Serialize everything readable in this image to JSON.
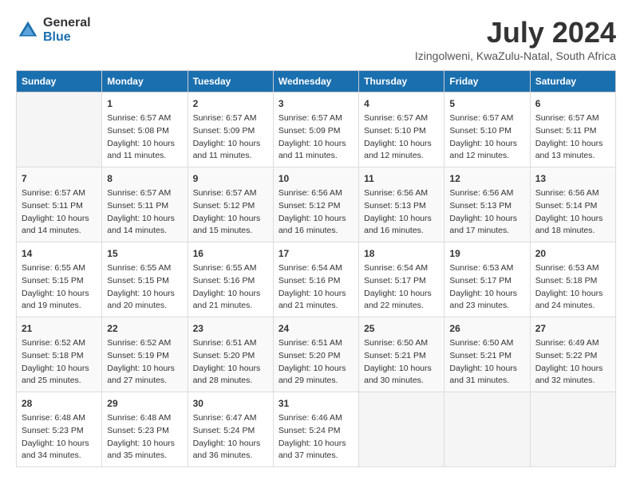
{
  "logo": {
    "general": "General",
    "blue": "Blue"
  },
  "title": "July 2024",
  "location": "Izingolweni, KwaZulu-Natal, South Africa",
  "days_of_week": [
    "Sunday",
    "Monday",
    "Tuesday",
    "Wednesday",
    "Thursday",
    "Friday",
    "Saturday"
  ],
  "weeks": [
    [
      {
        "day": "",
        "sunrise": "",
        "sunset": "",
        "daylight": ""
      },
      {
        "day": "1",
        "sunrise": "Sunrise: 6:57 AM",
        "sunset": "Sunset: 5:08 PM",
        "daylight": "Daylight: 10 hours and 11 minutes."
      },
      {
        "day": "2",
        "sunrise": "Sunrise: 6:57 AM",
        "sunset": "Sunset: 5:09 PM",
        "daylight": "Daylight: 10 hours and 11 minutes."
      },
      {
        "day": "3",
        "sunrise": "Sunrise: 6:57 AM",
        "sunset": "Sunset: 5:09 PM",
        "daylight": "Daylight: 10 hours and 11 minutes."
      },
      {
        "day": "4",
        "sunrise": "Sunrise: 6:57 AM",
        "sunset": "Sunset: 5:10 PM",
        "daylight": "Daylight: 10 hours and 12 minutes."
      },
      {
        "day": "5",
        "sunrise": "Sunrise: 6:57 AM",
        "sunset": "Sunset: 5:10 PM",
        "daylight": "Daylight: 10 hours and 12 minutes."
      },
      {
        "day": "6",
        "sunrise": "Sunrise: 6:57 AM",
        "sunset": "Sunset: 5:11 PM",
        "daylight": "Daylight: 10 hours and 13 minutes."
      }
    ],
    [
      {
        "day": "7",
        "sunrise": "Sunrise: 6:57 AM",
        "sunset": "Sunset: 5:11 PM",
        "daylight": "Daylight: 10 hours and 14 minutes."
      },
      {
        "day": "8",
        "sunrise": "Sunrise: 6:57 AM",
        "sunset": "Sunset: 5:11 PM",
        "daylight": "Daylight: 10 hours and 14 minutes."
      },
      {
        "day": "9",
        "sunrise": "Sunrise: 6:57 AM",
        "sunset": "Sunset: 5:12 PM",
        "daylight": "Daylight: 10 hours and 15 minutes."
      },
      {
        "day": "10",
        "sunrise": "Sunrise: 6:56 AM",
        "sunset": "Sunset: 5:12 PM",
        "daylight": "Daylight: 10 hours and 16 minutes."
      },
      {
        "day": "11",
        "sunrise": "Sunrise: 6:56 AM",
        "sunset": "Sunset: 5:13 PM",
        "daylight": "Daylight: 10 hours and 16 minutes."
      },
      {
        "day": "12",
        "sunrise": "Sunrise: 6:56 AM",
        "sunset": "Sunset: 5:13 PM",
        "daylight": "Daylight: 10 hours and 17 minutes."
      },
      {
        "day": "13",
        "sunrise": "Sunrise: 6:56 AM",
        "sunset": "Sunset: 5:14 PM",
        "daylight": "Daylight: 10 hours and 18 minutes."
      }
    ],
    [
      {
        "day": "14",
        "sunrise": "Sunrise: 6:55 AM",
        "sunset": "Sunset: 5:15 PM",
        "daylight": "Daylight: 10 hours and 19 minutes."
      },
      {
        "day": "15",
        "sunrise": "Sunrise: 6:55 AM",
        "sunset": "Sunset: 5:15 PM",
        "daylight": "Daylight: 10 hours and 20 minutes."
      },
      {
        "day": "16",
        "sunrise": "Sunrise: 6:55 AM",
        "sunset": "Sunset: 5:16 PM",
        "daylight": "Daylight: 10 hours and 21 minutes."
      },
      {
        "day": "17",
        "sunrise": "Sunrise: 6:54 AM",
        "sunset": "Sunset: 5:16 PM",
        "daylight": "Daylight: 10 hours and 21 minutes."
      },
      {
        "day": "18",
        "sunrise": "Sunrise: 6:54 AM",
        "sunset": "Sunset: 5:17 PM",
        "daylight": "Daylight: 10 hours and 22 minutes."
      },
      {
        "day": "19",
        "sunrise": "Sunrise: 6:53 AM",
        "sunset": "Sunset: 5:17 PM",
        "daylight": "Daylight: 10 hours and 23 minutes."
      },
      {
        "day": "20",
        "sunrise": "Sunrise: 6:53 AM",
        "sunset": "Sunset: 5:18 PM",
        "daylight": "Daylight: 10 hours and 24 minutes."
      }
    ],
    [
      {
        "day": "21",
        "sunrise": "Sunrise: 6:52 AM",
        "sunset": "Sunset: 5:18 PM",
        "daylight": "Daylight: 10 hours and 25 minutes."
      },
      {
        "day": "22",
        "sunrise": "Sunrise: 6:52 AM",
        "sunset": "Sunset: 5:19 PM",
        "daylight": "Daylight: 10 hours and 27 minutes."
      },
      {
        "day": "23",
        "sunrise": "Sunrise: 6:51 AM",
        "sunset": "Sunset: 5:20 PM",
        "daylight": "Daylight: 10 hours and 28 minutes."
      },
      {
        "day": "24",
        "sunrise": "Sunrise: 6:51 AM",
        "sunset": "Sunset: 5:20 PM",
        "daylight": "Daylight: 10 hours and 29 minutes."
      },
      {
        "day": "25",
        "sunrise": "Sunrise: 6:50 AM",
        "sunset": "Sunset: 5:21 PM",
        "daylight": "Daylight: 10 hours and 30 minutes."
      },
      {
        "day": "26",
        "sunrise": "Sunrise: 6:50 AM",
        "sunset": "Sunset: 5:21 PM",
        "daylight": "Daylight: 10 hours and 31 minutes."
      },
      {
        "day": "27",
        "sunrise": "Sunrise: 6:49 AM",
        "sunset": "Sunset: 5:22 PM",
        "daylight": "Daylight: 10 hours and 32 minutes."
      }
    ],
    [
      {
        "day": "28",
        "sunrise": "Sunrise: 6:48 AM",
        "sunset": "Sunset: 5:23 PM",
        "daylight": "Daylight: 10 hours and 34 minutes."
      },
      {
        "day": "29",
        "sunrise": "Sunrise: 6:48 AM",
        "sunset": "Sunset: 5:23 PM",
        "daylight": "Daylight: 10 hours and 35 minutes."
      },
      {
        "day": "30",
        "sunrise": "Sunrise: 6:47 AM",
        "sunset": "Sunset: 5:24 PM",
        "daylight": "Daylight: 10 hours and 36 minutes."
      },
      {
        "day": "31",
        "sunrise": "Sunrise: 6:46 AM",
        "sunset": "Sunset: 5:24 PM",
        "daylight": "Daylight: 10 hours and 37 minutes."
      },
      {
        "day": "",
        "sunrise": "",
        "sunset": "",
        "daylight": ""
      },
      {
        "day": "",
        "sunrise": "",
        "sunset": "",
        "daylight": ""
      },
      {
        "day": "",
        "sunrise": "",
        "sunset": "",
        "daylight": ""
      }
    ]
  ]
}
